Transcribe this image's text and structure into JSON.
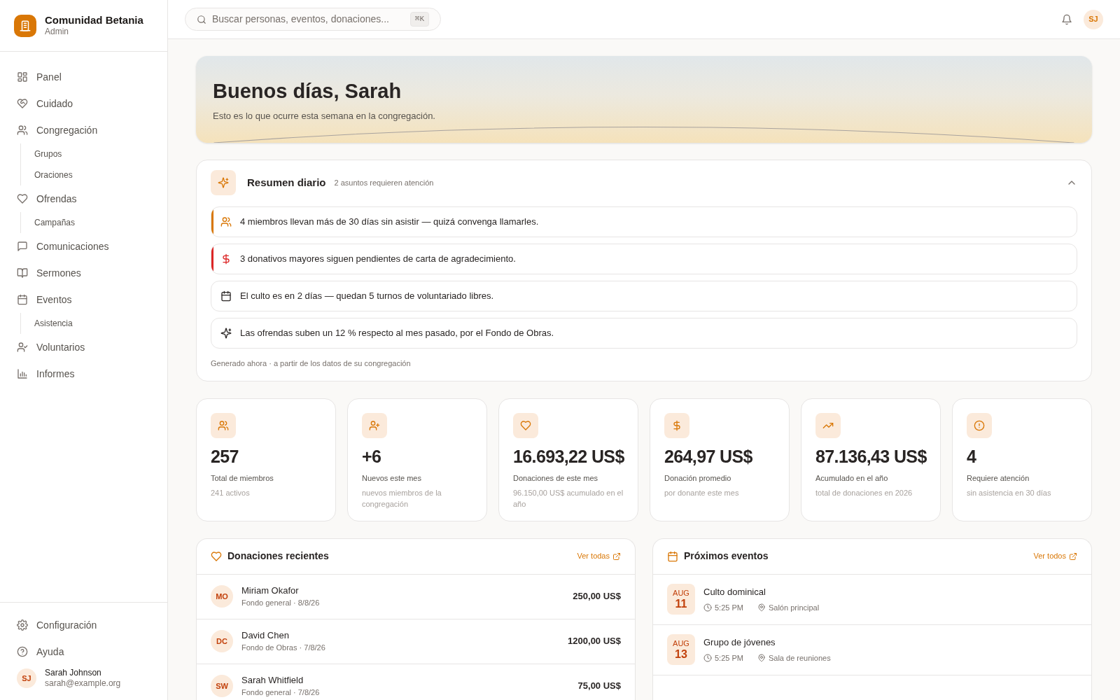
{
  "brand": {
    "name": "Comunidad Betania",
    "role": "Admin"
  },
  "nav": [
    {
      "label": "Panel",
      "selected": false
    },
    {
      "label": "Cuidado",
      "selected": false
    },
    {
      "label": "Congregación",
      "selected": false,
      "children": [
        {
          "label": "Grupos"
        },
        {
          "label": "Oraciones"
        }
      ]
    },
    {
      "label": "Ofrendas",
      "selected": false,
      "children": [
        {
          "label": "Campañas"
        }
      ]
    },
    {
      "label": "Comunicaciones",
      "selected": false
    },
    {
      "label": "Sermones",
      "selected": false
    },
    {
      "label": "Eventos",
      "selected": false,
      "children": [
        {
          "label": "Asistencia"
        }
      ]
    },
    {
      "label": "Voluntarios",
      "selected": false
    },
    {
      "label": "Informes",
      "selected": false
    }
  ],
  "footer_nav": [
    {
      "label": "Configuración"
    },
    {
      "label": "Ayuda"
    }
  ],
  "user": {
    "initials": "SJ",
    "name": "Sarah Johnson",
    "email": "sarah@example.org"
  },
  "search": {
    "placeholder": "Buscar personas, eventos, donaciones...",
    "shortcut": "⌘K"
  },
  "header_avatar": "SJ",
  "hero": {
    "title": "Buenos días, Sarah",
    "subtitle": "Esto es lo que ocurre esta semana en la congregación."
  },
  "summary": {
    "title": "Resumen diario",
    "note": "2 asuntos requieren atención",
    "expanded": true,
    "items": [
      {
        "color": "#d97706",
        "text": "4 miembros llevan más de 30 días sin asistir — quizá convenga llamarles."
      },
      {
        "color": "#dc2626",
        "text": "3 donativos mayores siguen pendientes de carta de agradecimiento."
      },
      {
        "text": "El culto es en 2 días — quedan 5 turnos de voluntariado libres."
      },
      {
        "text": "Las ofrendas suben un 12 % respecto al mes pasado, por el Fondo de Obras."
      }
    ],
    "footer": "Generado ahora · a partir de los datos de su congregación"
  },
  "stats": [
    {
      "value": "257",
      "label": "Total de miembros",
      "sub": "241 activos"
    },
    {
      "value": "+6",
      "label": "Nuevos este mes",
      "sub": "nuevos miembros de la congregación"
    },
    {
      "value": "16.693,22 US$",
      "label": "Donaciones de este mes",
      "sub": "96.150,00 US$ acumulado en el año"
    },
    {
      "value": "264,97 US$",
      "label": "Donación promedio",
      "sub": "por donante este mes"
    },
    {
      "value": "87.136,43 US$",
      "label": "Acumulado en el año",
      "sub": "total de donaciones en 2026"
    },
    {
      "value": "4",
      "label": "Requiere atención",
      "sub": "sin asistencia en 30 días"
    }
  ],
  "donations": {
    "title": "Donaciones recientes",
    "link": "Ver todas",
    "rows": [
      {
        "initials": "MO",
        "name": "Miriam Okafor",
        "detail": "Fondo general · 8/8/26",
        "amount": "250,00 US$"
      },
      {
        "initials": "DC",
        "name": "David Chen",
        "detail": "Fondo de Obras · 7/8/26",
        "amount": "1200,00 US$"
      },
      {
        "initials": "SW",
        "name": "Sarah Whitfield",
        "detail": "Fondo general · 7/8/26",
        "amount": "75,00 US$"
      }
    ]
  },
  "events": {
    "title": "Próximos eventos",
    "link": "Ver todos",
    "rows": [
      {
        "month": "AUG",
        "day": "11",
        "name": "Culto dominical",
        "time": "5:25 PM",
        "place": "Salón principal"
      },
      {
        "month": "AUG",
        "day": "13",
        "name": "Grupo de jóvenes",
        "time": "5:25 PM",
        "place": "Sala de reuniones"
      }
    ]
  }
}
